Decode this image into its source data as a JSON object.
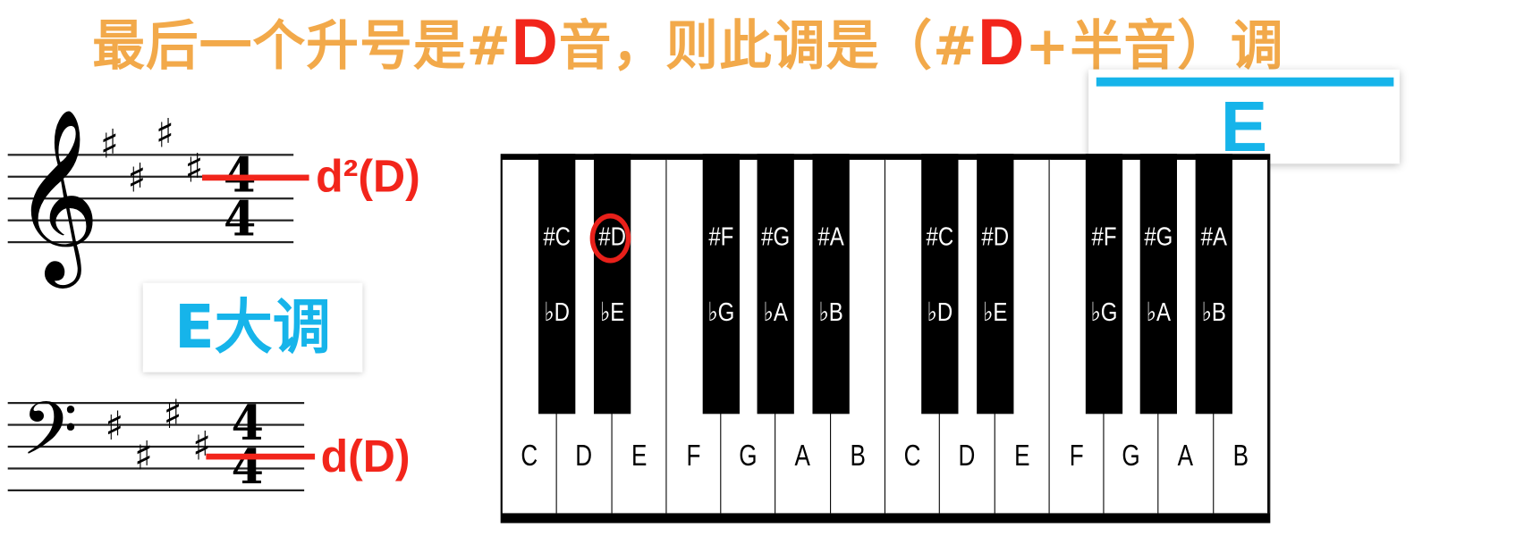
{
  "title": {
    "part1": "最后一个升号是#",
    "note1": "D",
    "part2": "音，则此调是（#",
    "note2": "D",
    "part3": "+半音）调"
  },
  "answer": {
    "text": "E"
  },
  "key_label": "E大调",
  "treble": {
    "clef": "𝄞",
    "sharps": [
      "♯",
      "♯",
      "♯",
      "♯"
    ],
    "time_top": "4",
    "time_bottom": "4",
    "note_label": "d²(D)"
  },
  "bass": {
    "clef": "𝄢",
    "sharps": [
      "♯",
      "♯",
      "♯",
      "♯"
    ],
    "time_top": "4",
    "time_bottom": "4",
    "note_label": "d(D)"
  },
  "piano": {
    "white_keys": [
      "C",
      "D",
      "E",
      "F",
      "G",
      "A",
      "B",
      "C",
      "D",
      "E",
      "F",
      "G",
      "A",
      "B"
    ],
    "black_keys": [
      {
        "sharp": "#C",
        "flat": "♭D"
      },
      {
        "sharp": "#D",
        "flat": "♭E",
        "highlight": true
      },
      {
        "sharp": "#F",
        "flat": "♭G"
      },
      {
        "sharp": "#G",
        "flat": "♭A"
      },
      {
        "sharp": "#A",
        "flat": "♭B"
      },
      {
        "sharp": "#C",
        "flat": "♭D"
      },
      {
        "sharp": "#D",
        "flat": "♭E"
      },
      {
        "sharp": "#F",
        "flat": "♭G"
      },
      {
        "sharp": "#G",
        "flat": "♭A"
      },
      {
        "sharp": "#A",
        "flat": "♭B"
      }
    ]
  },
  "colors": {
    "title": "#f2a94a",
    "highlight": "#f2251b",
    "accent": "#16b4ea"
  }
}
